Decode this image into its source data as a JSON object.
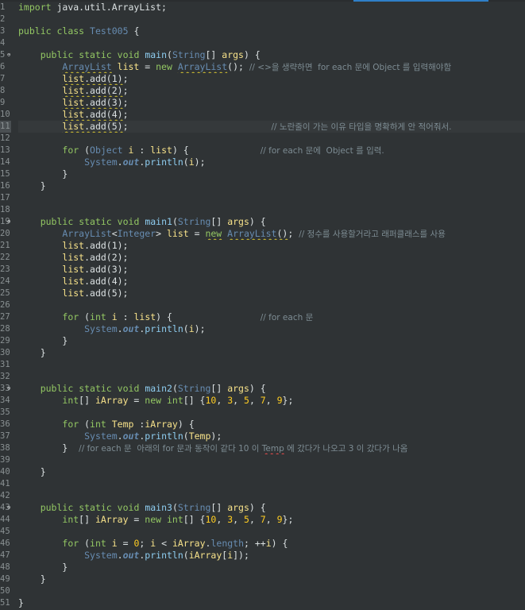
{
  "editor": {
    "colors": {
      "background": "#2f3335",
      "keyword": "#93c763",
      "type": "#678cb1",
      "method": "#8ecdf0",
      "variable": "#f7e28a",
      "number": "#ffcd22",
      "comment": "#7d8c93",
      "text": "#dbe1e2",
      "accent": "#2f7fc8"
    },
    "current_line": 11,
    "fold_markers": [
      "5",
      "19",
      "33",
      "43"
    ],
    "line_numbers": [
      "1",
      "2",
      "3",
      "4",
      "5",
      "6",
      "7",
      "8",
      "9",
      "10",
      "11",
      "12",
      "13",
      "14",
      "15",
      "16",
      "17",
      "18",
      "19",
      "20",
      "21",
      "22",
      "23",
      "24",
      "25",
      "26",
      "27",
      "28",
      "29",
      "30",
      "31",
      "32",
      "33",
      "34",
      "35",
      "36",
      "37",
      "38",
      "39",
      "40",
      "41",
      "42",
      "43",
      "44",
      "45",
      "46",
      "47",
      "48",
      "49",
      "50",
      "51"
    ],
    "lines": [
      [
        [
          "kw",
          "import"
        ],
        [
          "t",
          " java.util.ArrayList;"
        ]
      ],
      [],
      [
        [
          "kw",
          "public"
        ],
        [
          "t",
          " "
        ],
        [
          "kw",
          "class"
        ],
        [
          "t",
          " "
        ],
        [
          "ty",
          "Test005"
        ],
        [
          "t",
          " {"
        ]
      ],
      [],
      [
        [
          "t",
          "    "
        ],
        [
          "kw",
          "public"
        ],
        [
          "t",
          " "
        ],
        [
          "kw",
          "static"
        ],
        [
          "t",
          " "
        ],
        [
          "kw",
          "void"
        ],
        [
          "t",
          " "
        ],
        [
          "fn",
          "main"
        ],
        [
          "t",
          "("
        ],
        [
          "ty",
          "String"
        ],
        [
          "t",
          "[] "
        ],
        [
          "var",
          "args"
        ],
        [
          "t",
          ") {"
        ]
      ],
      [
        [
          "t",
          "        "
        ],
        [
          "ty warn",
          "ArrayList"
        ],
        [
          "t",
          " "
        ],
        [
          "var",
          "list"
        ],
        [
          "t",
          " = "
        ],
        [
          "kw",
          "new"
        ],
        [
          "t",
          " "
        ],
        [
          "ty warn",
          "ArrayList"
        ],
        [
          "t",
          "(); "
        ],
        [
          "cm",
          "// <>을 생략하면  for each 문에 Object 를 입력해야함"
        ]
      ],
      [
        [
          "t",
          "        "
        ],
        [
          "var warn",
          "list"
        ],
        [
          "t warn",
          ".add(1)"
        ],
        [
          "t",
          ";"
        ]
      ],
      [
        [
          "t",
          "        "
        ],
        [
          "var warn",
          "list"
        ],
        [
          "t warn",
          ".add(2)"
        ],
        [
          "t",
          ";"
        ]
      ],
      [
        [
          "t",
          "        "
        ],
        [
          "var warn",
          "list"
        ],
        [
          "t warn",
          ".add(3)"
        ],
        [
          "t",
          ";"
        ]
      ],
      [
        [
          "t",
          "        "
        ],
        [
          "var warn",
          "list"
        ],
        [
          "t warn",
          ".add(4)"
        ],
        [
          "t",
          ";"
        ]
      ],
      [
        [
          "t",
          "        "
        ],
        [
          "var warn",
          "list"
        ],
        [
          "t warn",
          ".add(5)"
        ],
        [
          "t",
          ";                          "
        ],
        [
          "cm",
          "// 노란줄이 가는 이유 타입을 명확하게 안 적어줘서."
        ]
      ],
      [],
      [
        [
          "t",
          "        "
        ],
        [
          "kw",
          "for"
        ],
        [
          "t",
          " ("
        ],
        [
          "ty",
          "Object"
        ],
        [
          "t",
          " "
        ],
        [
          "var",
          "i"
        ],
        [
          "t",
          " : "
        ],
        [
          "var",
          "list"
        ],
        [
          "t",
          ") {             "
        ],
        [
          "cm",
          "// for each 문에  Object 를 입력."
        ]
      ],
      [
        [
          "t",
          "            "
        ],
        [
          "ty",
          "System"
        ],
        [
          "t",
          "."
        ],
        [
          "fld",
          "out"
        ],
        [
          "t",
          "."
        ],
        [
          "fn",
          "println"
        ],
        [
          "t",
          "("
        ],
        [
          "var",
          "i"
        ],
        [
          "t",
          ");"
        ]
      ],
      [
        [
          "t",
          "        }"
        ]
      ],
      [
        [
          "t",
          "    }"
        ]
      ],
      [],
      [],
      [
        [
          "t",
          "    "
        ],
        [
          "kw",
          "public"
        ],
        [
          "t",
          " "
        ],
        [
          "kw",
          "static"
        ],
        [
          "t",
          " "
        ],
        [
          "kw",
          "void"
        ],
        [
          "t",
          " "
        ],
        [
          "fn",
          "main1"
        ],
        [
          "t",
          "("
        ],
        [
          "ty",
          "String"
        ],
        [
          "t",
          "[] "
        ],
        [
          "var",
          "args"
        ],
        [
          "t",
          ") {"
        ]
      ],
      [
        [
          "t",
          "        "
        ],
        [
          "ty",
          "ArrayList"
        ],
        [
          "t",
          "<"
        ],
        [
          "ty",
          "Integer"
        ],
        [
          "t",
          "> "
        ],
        [
          "var",
          "list"
        ],
        [
          "t",
          " = "
        ],
        [
          "kw warn",
          "new"
        ],
        [
          "t",
          " "
        ],
        [
          "ty warn",
          "ArrayList"
        ],
        [
          "t warn",
          "()"
        ],
        [
          "t",
          "; "
        ],
        [
          "cm",
          "// 정수를 사용할거라고 래퍼클래스를 사용"
        ]
      ],
      [
        [
          "t",
          "        "
        ],
        [
          "var",
          "list"
        ],
        [
          "t",
          ".add(1);"
        ]
      ],
      [
        [
          "t",
          "        "
        ],
        [
          "var",
          "list"
        ],
        [
          "t",
          ".add(2);"
        ]
      ],
      [
        [
          "t",
          "        "
        ],
        [
          "var",
          "list"
        ],
        [
          "t",
          ".add(3);"
        ]
      ],
      [
        [
          "t",
          "        "
        ],
        [
          "var",
          "list"
        ],
        [
          "t",
          ".add(4);"
        ]
      ],
      [
        [
          "t",
          "        "
        ],
        [
          "var",
          "list"
        ],
        [
          "t",
          ".add(5);"
        ]
      ],
      [],
      [
        [
          "t",
          "        "
        ],
        [
          "kw",
          "for"
        ],
        [
          "t",
          " ("
        ],
        [
          "kw",
          "int"
        ],
        [
          "t",
          " "
        ],
        [
          "var",
          "i"
        ],
        [
          "t",
          " : "
        ],
        [
          "var",
          "list"
        ],
        [
          "t",
          ") {                "
        ],
        [
          "cm",
          "// for each 문"
        ]
      ],
      [
        [
          "t",
          "            "
        ],
        [
          "ty",
          "System"
        ],
        [
          "t",
          "."
        ],
        [
          "fld",
          "out"
        ],
        [
          "t",
          "."
        ],
        [
          "fn",
          "println"
        ],
        [
          "t",
          "("
        ],
        [
          "var",
          "i"
        ],
        [
          "t",
          ");"
        ]
      ],
      [
        [
          "t",
          "        }"
        ]
      ],
      [
        [
          "t",
          "    }"
        ]
      ],
      [],
      [],
      [
        [
          "t",
          "    "
        ],
        [
          "kw",
          "public"
        ],
        [
          "t",
          " "
        ],
        [
          "kw",
          "static"
        ],
        [
          "t",
          " "
        ],
        [
          "kw",
          "void"
        ],
        [
          "t",
          " "
        ],
        [
          "fn",
          "main2"
        ],
        [
          "t",
          "("
        ],
        [
          "ty",
          "String"
        ],
        [
          "t",
          "[] "
        ],
        [
          "var",
          "args"
        ],
        [
          "t",
          ") {"
        ]
      ],
      [
        [
          "t",
          "        "
        ],
        [
          "kw",
          "int"
        ],
        [
          "t",
          "[] "
        ],
        [
          "var",
          "iArray"
        ],
        [
          "t",
          " = "
        ],
        [
          "kw",
          "new"
        ],
        [
          "t",
          " "
        ],
        [
          "kw",
          "int"
        ],
        [
          "t",
          "[] {"
        ],
        [
          "num",
          "10"
        ],
        [
          "t",
          ", "
        ],
        [
          "num",
          "3"
        ],
        [
          "t",
          ", "
        ],
        [
          "num",
          "5"
        ],
        [
          "t",
          ", "
        ],
        [
          "num",
          "7"
        ],
        [
          "t",
          ", "
        ],
        [
          "num",
          "9"
        ],
        [
          "t",
          "};"
        ]
      ],
      [],
      [
        [
          "t",
          "        "
        ],
        [
          "kw",
          "for"
        ],
        [
          "t",
          " ("
        ],
        [
          "kw",
          "int"
        ],
        [
          "t",
          " "
        ],
        [
          "var",
          "Temp"
        ],
        [
          "t",
          " :"
        ],
        [
          "var",
          "iArray"
        ],
        [
          "t",
          ") {"
        ]
      ],
      [
        [
          "t",
          "            "
        ],
        [
          "ty",
          "System"
        ],
        [
          "t",
          "."
        ],
        [
          "fld",
          "out"
        ],
        [
          "t",
          "."
        ],
        [
          "fn",
          "println"
        ],
        [
          "t",
          "("
        ],
        [
          "var",
          "Temp"
        ],
        [
          "t",
          ");"
        ]
      ],
      [
        [
          "t",
          "        }  "
        ],
        [
          "cm",
          "// for each 문  아래의 for 문과 동작이 같다 10 이 "
        ],
        [
          "cm err",
          "Temp"
        ],
        [
          "cm",
          " 에 갔다가 나오고 3 이 갔다가 나옴"
        ]
      ],
      [],
      [
        [
          "t",
          "    }"
        ]
      ],
      [],
      [],
      [
        [
          "t",
          "    "
        ],
        [
          "kw",
          "public"
        ],
        [
          "t",
          " "
        ],
        [
          "kw",
          "static"
        ],
        [
          "t",
          " "
        ],
        [
          "kw",
          "void"
        ],
        [
          "t",
          " "
        ],
        [
          "fn",
          "main3"
        ],
        [
          "t",
          "("
        ],
        [
          "ty",
          "String"
        ],
        [
          "t",
          "[] "
        ],
        [
          "var",
          "args"
        ],
        [
          "t",
          ") {"
        ]
      ],
      [
        [
          "t",
          "        "
        ],
        [
          "kw",
          "int"
        ],
        [
          "t",
          "[] "
        ],
        [
          "var",
          "iArray"
        ],
        [
          "t",
          " = "
        ],
        [
          "kw",
          "new"
        ],
        [
          "t",
          " "
        ],
        [
          "kw",
          "int"
        ],
        [
          "t",
          "[] {"
        ],
        [
          "num",
          "10"
        ],
        [
          "t",
          ", "
        ],
        [
          "num",
          "3"
        ],
        [
          "t",
          ", "
        ],
        [
          "num",
          "5"
        ],
        [
          "t",
          ", "
        ],
        [
          "num",
          "7"
        ],
        [
          "t",
          ", "
        ],
        [
          "num",
          "9"
        ],
        [
          "t",
          "};"
        ]
      ],
      [],
      [
        [
          "t",
          "        "
        ],
        [
          "kw",
          "for"
        ],
        [
          "t",
          " ("
        ],
        [
          "kw",
          "int"
        ],
        [
          "t",
          " "
        ],
        [
          "var",
          "i"
        ],
        [
          "t",
          " = "
        ],
        [
          "num",
          "0"
        ],
        [
          "t",
          "; "
        ],
        [
          "var",
          "i"
        ],
        [
          "t",
          " < "
        ],
        [
          "var",
          "iArray"
        ],
        [
          "t",
          "."
        ],
        [
          "ty",
          "length"
        ],
        [
          "t",
          "; ++"
        ],
        [
          "var",
          "i"
        ],
        [
          "t",
          ") {"
        ]
      ],
      [
        [
          "t",
          "            "
        ],
        [
          "ty",
          "System"
        ],
        [
          "t",
          "."
        ],
        [
          "fld",
          "out"
        ],
        [
          "t",
          "."
        ],
        [
          "fn",
          "println"
        ],
        [
          "t",
          "("
        ],
        [
          "var",
          "iArray"
        ],
        [
          "t",
          "["
        ],
        [
          "var",
          "i"
        ],
        [
          "t",
          "]);"
        ]
      ],
      [
        [
          "t",
          "        }"
        ]
      ],
      [
        [
          "t",
          "    }"
        ]
      ],
      [],
      [
        [
          "t",
          "}"
        ]
      ]
    ]
  }
}
